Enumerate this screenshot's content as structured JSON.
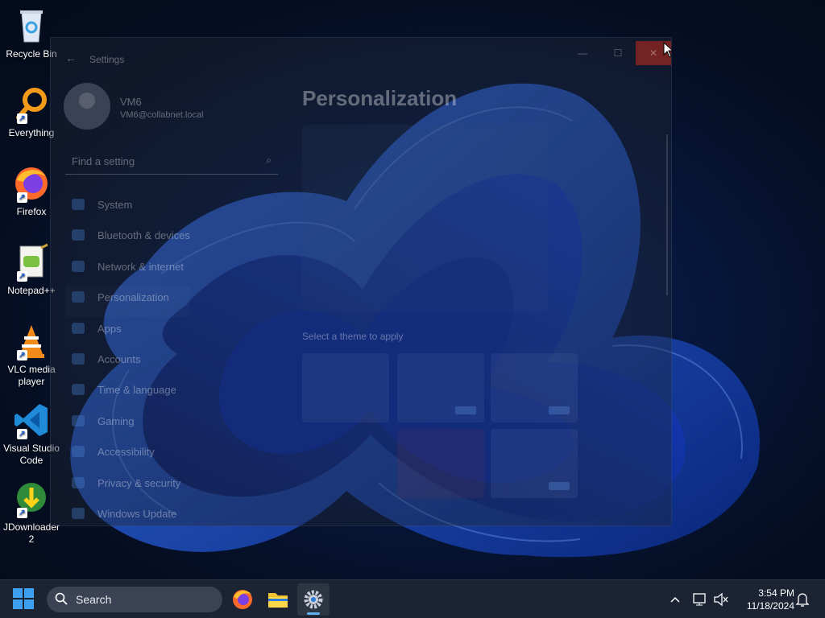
{
  "desktop": {
    "icons": [
      {
        "label": "Recycle Bin",
        "icon": "recycle-bin-icon"
      },
      {
        "label": "Everything",
        "icon": "everything-search-icon"
      },
      {
        "label": "Firefox",
        "icon": "firefox-icon"
      },
      {
        "label": "Notepad++",
        "icon": "notepad-plus-plus-icon"
      },
      {
        "label": "VLC media player",
        "icon": "vlc-icon"
      },
      {
        "label": "Visual Studio Code",
        "icon": "vscode-icon"
      },
      {
        "label": "JDownloader 2",
        "icon": "jdownloader-icon"
      }
    ]
  },
  "settings": {
    "title": "Settings",
    "back": "←",
    "controls": {
      "minimize": "—",
      "maximize": "☐",
      "close": "✕"
    },
    "user": {
      "name": "VM6",
      "email": "VM6@collabnet.local"
    },
    "search_placeholder": "Find a setting",
    "nav": [
      {
        "label": "System"
      },
      {
        "label": "Bluetooth & devices"
      },
      {
        "label": "Network & internet"
      },
      {
        "label": "Personalization"
      },
      {
        "label": "Apps"
      },
      {
        "label": "Accounts"
      },
      {
        "label": "Time & language"
      },
      {
        "label": "Gaming"
      },
      {
        "label": "Accessibility"
      },
      {
        "label": "Privacy & security"
      },
      {
        "label": "Windows Update"
      }
    ],
    "page_title": "Personalization",
    "theme_hint": "Select a theme to apply"
  },
  "taskbar": {
    "search_label": "Search",
    "clock": {
      "time": "3:54 PM",
      "date": "11/18/2024"
    },
    "accent": "#3ea0f0"
  }
}
